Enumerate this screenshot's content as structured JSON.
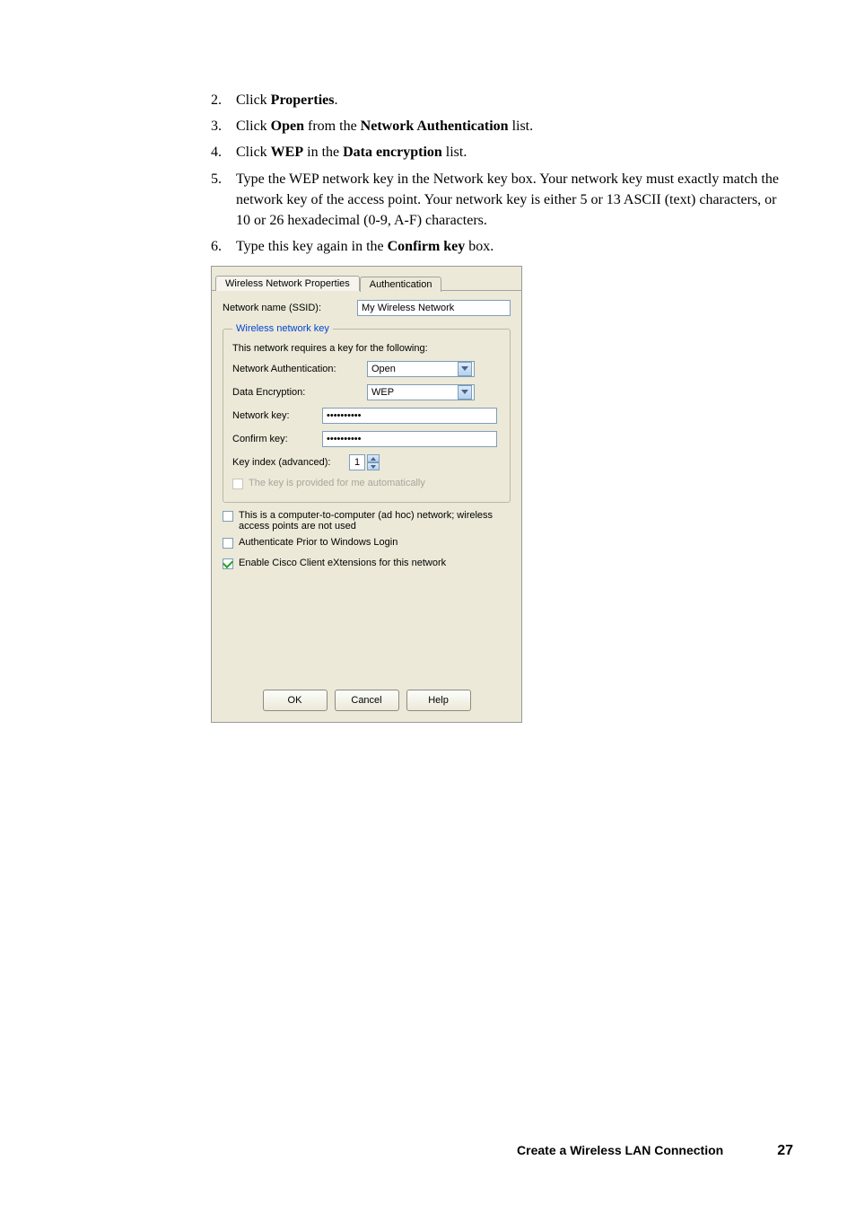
{
  "steps": [
    {
      "num": "2.",
      "parts": [
        "Click ",
        {
          "b": true,
          "t": "Properties"
        },
        "."
      ]
    },
    {
      "num": "3.",
      "parts": [
        "Click ",
        {
          "b": true,
          "t": "Open"
        },
        " from the ",
        {
          "b": true,
          "t": "Network Authentication"
        },
        " list."
      ]
    },
    {
      "num": "4.",
      "parts": [
        "Click ",
        {
          "b": true,
          "t": "WEP"
        },
        " in the ",
        {
          "b": true,
          "t": "Data encryption"
        },
        " list."
      ]
    },
    {
      "num": "5.",
      "parts": [
        "Type the WEP network key in the Network key box. Your network key must exactly match the network key of the access point. Your network key is either 5 or 13 ASCII (text) characters, or 10 or 26 hexadecimal (0-9, A-F) characters."
      ]
    },
    {
      "num": "6.",
      "parts": [
        "Type this key again in the ",
        {
          "b": true,
          "t": "Confirm key"
        },
        " box."
      ]
    }
  ],
  "dialog": {
    "tabs": {
      "active": "Wireless Network Properties",
      "passive": "Authentication"
    },
    "ssid": {
      "label": "Network name (SSID):",
      "value": "My Wireless Network"
    },
    "group_legend": "Wireless network key",
    "group_note": "This network requires a key for the following:",
    "auth": {
      "label": "Network Authentication:",
      "value": "Open"
    },
    "enc": {
      "label": "Data Encryption:",
      "value": "WEP"
    },
    "netkey": {
      "label": "Network key:",
      "value": "••••••••••"
    },
    "confkey": {
      "label": "Confirm key:",
      "value": "••••••••••"
    },
    "keyidx": {
      "label": "Key index (advanced):",
      "value": "1"
    },
    "auto_cb": "The key is provided for me automatically",
    "adhoc_cb": "This is a computer-to-computer (ad hoc) network; wireless access points are not used",
    "prior_cb": "Authenticate Prior to Windows Login",
    "cisco_cb": "Enable Cisco Client eXtensions for this network",
    "buttons": {
      "ok": "OK",
      "cancel": "Cancel",
      "help": "Help"
    }
  },
  "footer": {
    "title": "Create a Wireless LAN Connection",
    "page": "27"
  }
}
